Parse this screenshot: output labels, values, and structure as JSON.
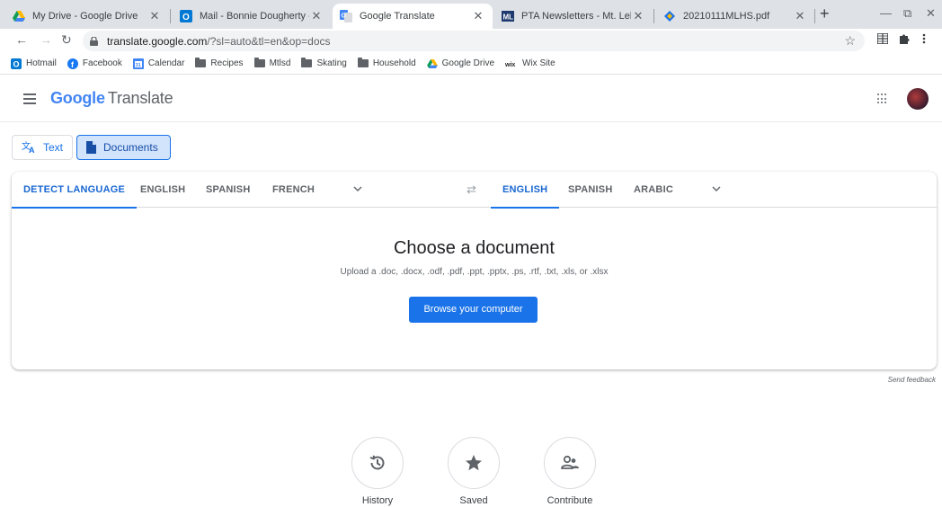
{
  "browser": {
    "tabs": [
      {
        "title": "My Drive - Google Drive",
        "icon": "google-drive-icon"
      },
      {
        "title": "Mail - Bonnie Dougherty - Outl",
        "icon": "outlook-icon"
      },
      {
        "title": "Google Translate",
        "icon": "google-translate-icon",
        "active": true
      },
      {
        "title": "PTA Newsletters - Mt. Lebano",
        "icon": "pta-icon"
      },
      {
        "title": "20210111MLHS.pdf",
        "icon": "pdf-icon"
      }
    ],
    "new_tab": "+",
    "url_host": "translate.google.com",
    "url_path": "/?sl=auto&tl=en&op=docs"
  },
  "bookmarks": [
    {
      "label": "Hotmail",
      "icon": "outlook-icon"
    },
    {
      "label": "Facebook",
      "icon": "facebook-icon"
    },
    {
      "label": "Calendar",
      "icon": "calendar-icon"
    },
    {
      "label": "Recipes",
      "icon": "folder-icon"
    },
    {
      "label": "Mtlsd",
      "icon": "folder-icon"
    },
    {
      "label": "Skating",
      "icon": "folder-icon"
    },
    {
      "label": "Household",
      "icon": "folder-icon"
    },
    {
      "label": "Google Drive",
      "icon": "google-drive-icon"
    },
    {
      "label": "Wix Site",
      "icon": "wix-icon"
    }
  ],
  "app": {
    "brand_google": "Google",
    "brand_product": "Translate"
  },
  "modes": {
    "text": "Text",
    "documents": "Documents"
  },
  "source_langs": [
    "DETECT LANGUAGE",
    "ENGLISH",
    "SPANISH",
    "FRENCH"
  ],
  "target_langs": [
    "ENGLISH",
    "SPANISH",
    "ARABIC"
  ],
  "document": {
    "title": "Choose a document",
    "subtitle": "Upload a .doc, .docx, .odf, .pdf, .ppt, .pptx, .ps, .rtf, .txt, .xls, or .xlsx",
    "browse": "Browse your computer"
  },
  "feedback": "Send feedback",
  "bottom": {
    "history": "History",
    "saved": "Saved",
    "contribute": "Contribute"
  },
  "colors": {
    "accent": "#1a73e8",
    "selected_bg": "#d2e3fc"
  }
}
